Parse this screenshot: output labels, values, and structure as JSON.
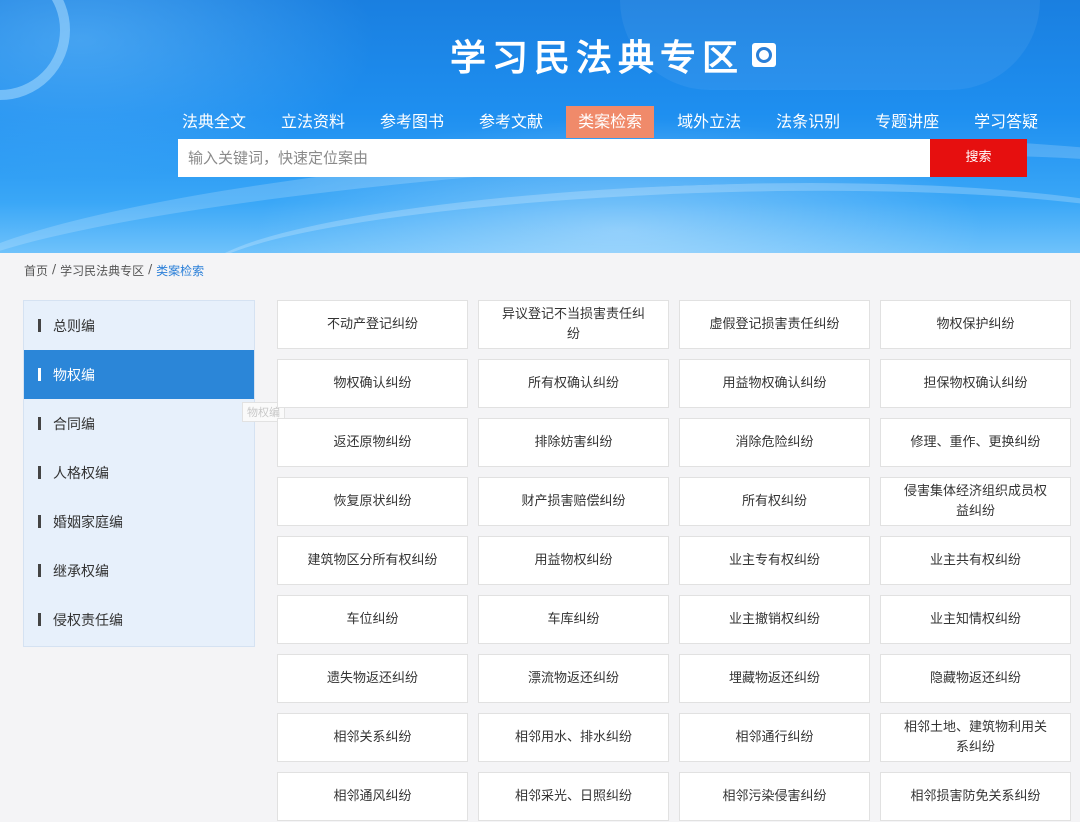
{
  "header": {
    "site_title": "学习民法典专区",
    "emblem_icon": "national-emblem-icon",
    "nav": [
      {
        "label": "法典全文"
      },
      {
        "label": "立法资料"
      },
      {
        "label": "参考图书"
      },
      {
        "label": "参考文献"
      },
      {
        "label": "类案检索",
        "active": true
      },
      {
        "label": "域外立法"
      },
      {
        "label": "法条识别"
      },
      {
        "label": "专题讲座"
      },
      {
        "label": "学习答疑"
      }
    ],
    "search": {
      "placeholder": "输入关键词，快速定位案由",
      "button_label": "搜索"
    }
  },
  "breadcrumb": {
    "items": [
      "首页",
      "学习民法典专区",
      "类案检索"
    ],
    "separator": "/"
  },
  "sidebar": {
    "items": [
      {
        "label": "总则编"
      },
      {
        "label": "物权编",
        "active": true
      },
      {
        "label": "合同编"
      },
      {
        "label": "人格权编"
      },
      {
        "label": "婚姻家庭编"
      },
      {
        "label": "继承权编"
      },
      {
        "label": "侵权责任编"
      }
    ],
    "tooltip": "物权编"
  },
  "cases": [
    "不动产登记纠纷",
    "异议登记不当损害责任纠纷",
    "虚假登记损害责任纠纷",
    "物权保护纠纷",
    "物权确认纠纷",
    "所有权确认纠纷",
    "用益物权确认纠纷",
    "担保物权确认纠纷",
    "返还原物纠纷",
    "排除妨害纠纷",
    "消除危险纠纷",
    "修理、重作、更换纠纷",
    "恢复原状纠纷",
    "财产损害赔偿纠纷",
    "所有权纠纷",
    "侵害集体经济组织成员权益纠纷",
    "建筑物区分所有权纠纷",
    "用益物权纠纷",
    "业主专有权纠纷",
    "业主共有权纠纷",
    "车位纠纷",
    "车库纠纷",
    "业主撤销权纠纷",
    "业主知情权纠纷",
    "遗失物返还纠纷",
    "漂流物返还纠纷",
    "埋藏物返还纠纷",
    "隐藏物返还纠纷",
    "相邻关系纠纷",
    "相邻用水、排水纠纷",
    "相邻通行纠纷",
    "相邻土地、建筑物利用关系纠纷",
    "相邻通风纠纷",
    "相邻采光、日照纠纷",
    "相邻污染侵害纠纷",
    "相邻损害防免关系纠纷"
  ],
  "colors": {
    "banner": "#1e8ff0",
    "nav_active": "#f08a6a",
    "search_button": "#e60f0f",
    "sidebar_active": "#2b86d8",
    "breadcrumb_current": "#2a7fd8"
  }
}
